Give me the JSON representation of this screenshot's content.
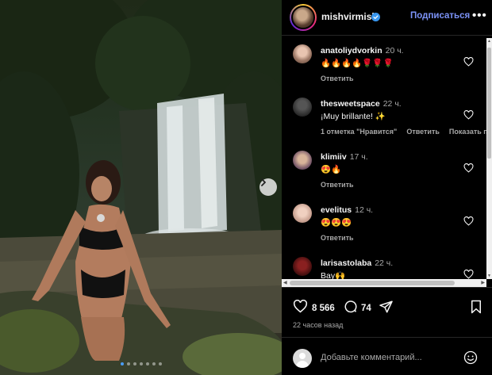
{
  "post": {
    "username": "mishvirmish",
    "follow_label": "Подписаться",
    "more_label": "•••",
    "likes": "8 566",
    "comments_count": "74",
    "posted_ago": "22 часов назад",
    "add_comment_placeholder": "Добавьте комментарий...",
    "carousel_total": 7,
    "carousel_active": 0
  },
  "comments": [
    {
      "user": "anatoliydvorkin",
      "time": "20 ч.",
      "text": "🔥🔥🔥🔥🌹🌹🌹",
      "actions": [
        "Ответить"
      ]
    },
    {
      "user": "thesweetspace",
      "time": "22 ч.",
      "text": "¡Muy brillante! ✨",
      "actions": [
        "1 отметка \"Нравится\"",
        "Ответить",
        "Показать пе"
      ]
    },
    {
      "user": "klimiiv",
      "time": "17 ч.",
      "text": "😍🔥",
      "actions": [
        "Ответить"
      ]
    },
    {
      "user": "evelitus",
      "time": "12 ч.",
      "text": "😍😍😍",
      "actions": [
        "Ответить"
      ]
    },
    {
      "user": "larisastolaba",
      "time": "22 ч.",
      "text": "Bay🙌",
      "actions": []
    }
  ],
  "colors": {
    "accent": "#7c93f8",
    "verified": "#3897f0",
    "active_dot": "#4a9df8"
  }
}
